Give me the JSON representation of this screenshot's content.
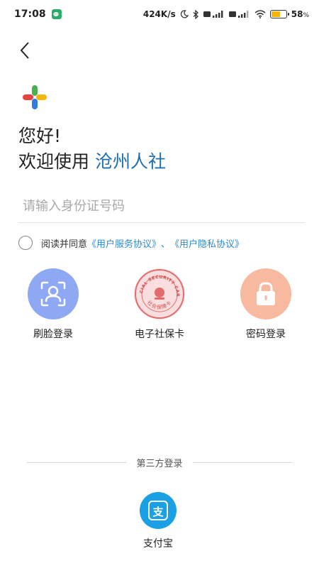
{
  "status_bar": {
    "time": "17:08",
    "net_speed": "424K/s",
    "battery": "58",
    "battery_unit": "%"
  },
  "header": {
    "back_icon": "chevron-left-icon"
  },
  "greeting": {
    "line1": "您好!",
    "line2_prefix": "欢迎使用",
    "app_name": "沧州人社",
    "brand_color": "#1f6fae"
  },
  "id_input": {
    "placeholder": "请输入身份证号码",
    "value": ""
  },
  "agreement": {
    "prefix": "阅读并同意",
    "user_service": "《用户服务协议》",
    "separator": "、",
    "privacy": "《用户隐私协议》",
    "link_color": "#2d8bd6"
  },
  "login_methods": [
    {
      "label": "刷脸登录",
      "icon": "face-id-icon",
      "color": "#7f9ff3"
    },
    {
      "label": "电子社保卡",
      "icon": "social-security-card-icon",
      "color": "#e46b6b",
      "seal_text": "SOCIAL SECURITY CARD",
      "seal_text_cn": "社会保障卡"
    },
    {
      "label": "密码登录",
      "icon": "lock-icon",
      "color": "#f6b49b"
    }
  ],
  "third_party": {
    "title": "第三方登录",
    "alipay_label": "支付宝",
    "alipay_icon": "alipay-icon",
    "alipay_color": "#1aa1e5",
    "alipay_glyph": "支"
  }
}
